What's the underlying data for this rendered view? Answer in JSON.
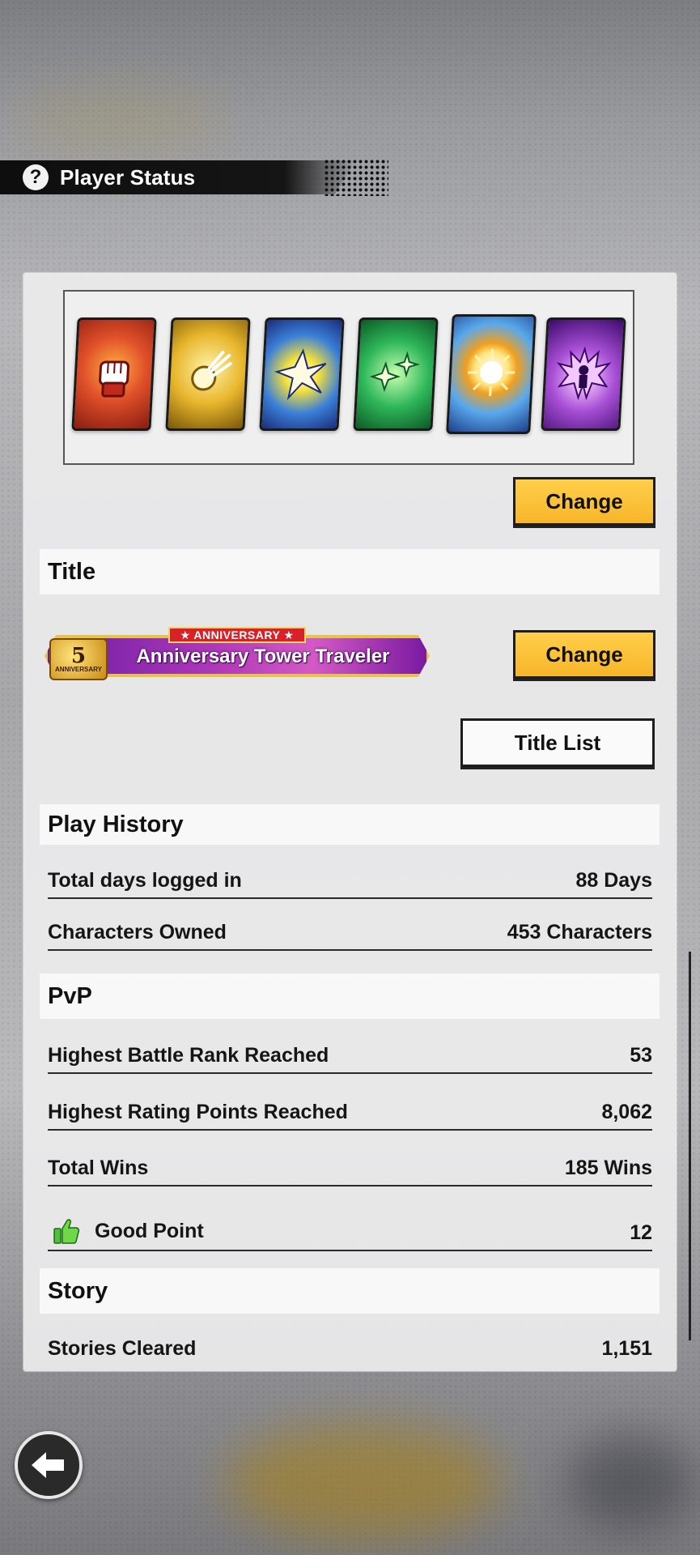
{
  "header": {
    "title": "Player Status",
    "help_icon": "question-circle-icon"
  },
  "deck": {
    "cards": [
      {
        "name": "fist-card-icon",
        "color": "#e0502a"
      },
      {
        "name": "ki-blast-card-icon",
        "color": "#e8b62c"
      },
      {
        "name": "clash-card-icon",
        "color": "#3a7fd8"
      },
      {
        "name": "sparkle-card-icon",
        "color": "#2eb75a"
      },
      {
        "name": "burst-card-icon",
        "color": "#5aa8ec"
      },
      {
        "name": "aura-card-icon",
        "color": "#a84fd6"
      }
    ],
    "change_label": "Change"
  },
  "title_section": {
    "heading": "Title",
    "banner_tag": "★ ANNIVERSARY ★",
    "banner_text": "Anniversary Tower Traveler",
    "badge_number": "5",
    "badge_sub": "ANNIVERSARY",
    "change_label": "Change",
    "title_list_label": "Title List"
  },
  "play_history": {
    "heading": "Play History",
    "rows": [
      {
        "label": "Total days logged in",
        "value": "88 Days"
      },
      {
        "label": "Characters Owned",
        "value": "453 Characters"
      }
    ]
  },
  "pvp": {
    "heading": "PvP",
    "rows": [
      {
        "label": "Highest Battle Rank Reached",
        "value": "53"
      },
      {
        "label": "Highest Rating Points Reached",
        "value": "8,062"
      },
      {
        "label": "Total Wins",
        "value": "185 Wins"
      },
      {
        "label": "Good Point",
        "value": "12",
        "icon": "thumbs-up-icon"
      }
    ]
  },
  "story": {
    "heading": "Story",
    "rows": [
      {
        "label": "Stories Cleared",
        "value": "1,151"
      }
    ]
  },
  "footer": {
    "back_icon": "back-arrow-icon"
  }
}
